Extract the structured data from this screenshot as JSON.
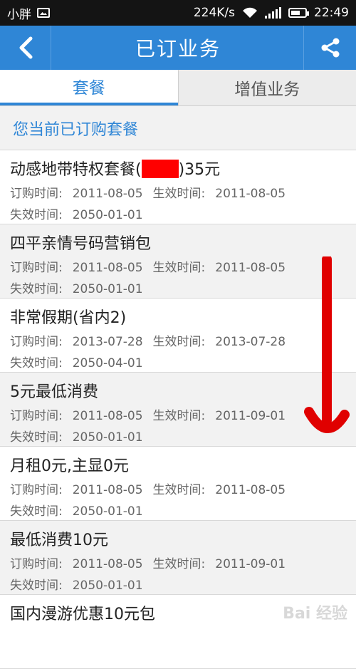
{
  "status_bar": {
    "left_text": "小胖",
    "speed": "224K/s",
    "time": "22:49"
  },
  "header": {
    "title": "已订业务"
  },
  "tabs": [
    {
      "label": "套餐",
      "active": true
    },
    {
      "label": "增值业务",
      "active": false
    }
  ],
  "section": {
    "title": "您当前已订购套餐"
  },
  "labels": {
    "order_time": "订购时间:",
    "effective_time": "生效时间:",
    "expire_time": "失效时间:"
  },
  "items": [
    {
      "name_prefix": "动感地带特权套餐(",
      "name_suffix": ")35元",
      "order": "2011-08-05",
      "effective": "2011-08-05",
      "expire": "2050-01-01"
    },
    {
      "name": "四平亲情号码营销包",
      "order": "2011-08-05",
      "effective": "2011-08-05",
      "expire": "2050-01-01"
    },
    {
      "name": "非常假期(省内2)",
      "order": "2013-07-28",
      "effective": "2013-07-28",
      "expire": "2050-04-01"
    },
    {
      "name": "5元最低消费",
      "order": "2011-08-05",
      "effective": "2011-09-01",
      "expire": "2050-01-01"
    },
    {
      "name": "月租0元,主显0元",
      "order": "2011-08-05",
      "effective": "2011-08-05",
      "expire": "2050-01-01"
    },
    {
      "name": "最低消费10元",
      "order": "2011-08-05",
      "effective": "2011-09-01",
      "expire": "2050-01-01"
    },
    {
      "name": "国内漫游优惠10元包"
    }
  ],
  "colors": {
    "accent": "#2f86d6",
    "status_bar": "#141414",
    "annotation_arrow": "#e00000"
  },
  "watermark": "Bai 经验"
}
